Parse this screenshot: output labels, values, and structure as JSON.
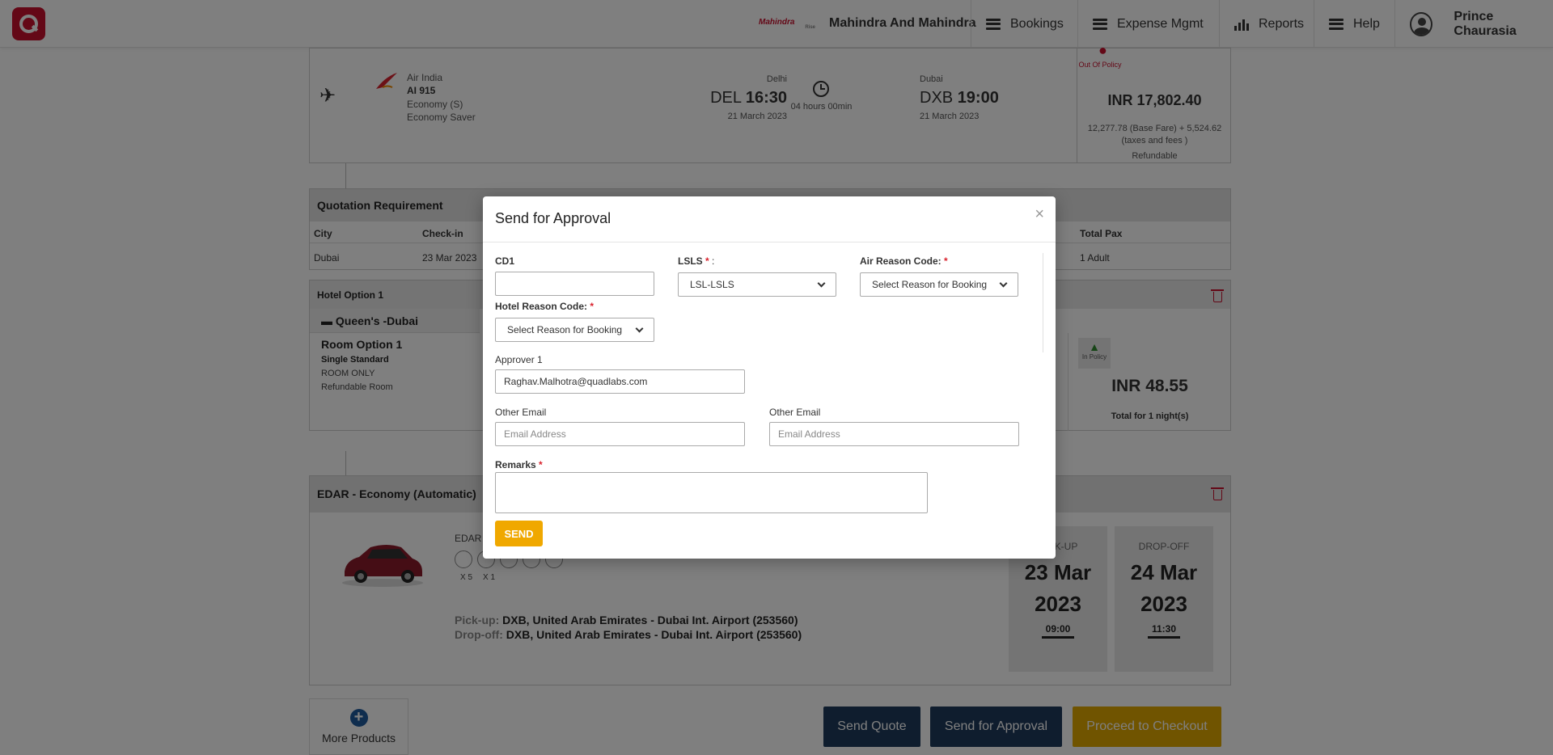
{
  "nav": {
    "brand_logo_text": "Mahindra",
    "brand_logo_sub": "Rise",
    "company": "Mahindra And Mahindra",
    "items": [
      {
        "label": "Bookings"
      },
      {
        "label": "Expense Mgmt"
      },
      {
        "label": "Reports"
      },
      {
        "label": "Help"
      }
    ],
    "user_name": "Prince Chaurasia"
  },
  "flight": {
    "airline": "Air India",
    "flight_no": "AI 915",
    "cabin": "Economy (S)",
    "fare_type": "Economy Saver",
    "from_city": "Delhi",
    "from_code": "DEL",
    "dep_time": "16:30",
    "dep_date": "21 March 2023",
    "duration": "04 hours 00min",
    "to_city": "Dubai",
    "to_code": "DXB",
    "arr_time": "19:00",
    "arr_date": "21 March 2023",
    "policy": "Out Of Policy",
    "price": "INR 17,802.40",
    "breakdown_1": "12,277.78 (Base Fare) + 5,524.62",
    "breakdown_2": "(taxes and fees )",
    "refund": "Refundable"
  },
  "quotation": {
    "title": "Quotation Requirement",
    "headers": {
      "city": "City",
      "checkin": "Check-in",
      "total_pax": "Total Pax"
    },
    "row": {
      "city": "Dubai",
      "checkin": "23 Mar 2023",
      "total_pax": "1 Adult"
    }
  },
  "hotel": {
    "option_title": "Hotel Option 1",
    "name": "Queen's -Dubai",
    "room_option": "Room Option 1",
    "room_type": "Single Standard",
    "meal": "ROOM ONLY",
    "refund": "Refundable Room",
    "policy": "In Policy",
    "price": "INR 48.55",
    "price_note": "Total for 1 night(s)"
  },
  "car": {
    "title": "EDAR - Economy (Automatic)",
    "code": "EDAR",
    "seats": "X 5",
    "bags": "X 1",
    "pickup_label": "Pick-up:",
    "pickup_value": "DXB, United Arab Emirates - Dubai Int. Airport (253560)",
    "dropoff_label": "Drop-off:",
    "dropoff_value": "DXB, United Arab Emirates - Dubai Int. Airport (253560)",
    "pickup_box_label": "PICK-UP",
    "pickup_date_1": "23 Mar",
    "pickup_date_2": "2023",
    "pickup_time": "09:00",
    "dropoff_box_label": "DROP-OFF",
    "dropoff_date_1": "24 Mar",
    "dropoff_date_2": "2023",
    "dropoff_time": "11:30"
  },
  "footer": {
    "more_products": "More Products",
    "send_quote": "Send Quote",
    "send_for_approval": "Send for Approval",
    "proceed": "Proceed to Checkout"
  },
  "modal": {
    "title": "Send for Approval",
    "close": "×",
    "cd1_label": "CD1",
    "cd1_value": "",
    "lsls_label": "LSLS",
    "lsls_suffix": " :",
    "lsls_value": "LSL-LSLS",
    "air_reason_label": "Air Reason Code:",
    "air_reason_value": "Select Reason for Booking",
    "hotel_reason_label": "Hotel Reason Code:",
    "hotel_reason_value": "Select Reason for Booking",
    "required_mark": "*",
    "approver_label": "Approver 1",
    "approver_value": "Raghav.Malhotra@quadlabs.com",
    "other_email_label_1": "Other Email",
    "other_email_label_2": "Other Email",
    "email_placeholder": "Email Address",
    "remarks_label": "Remarks",
    "send_label": "SEND"
  },
  "colors": {
    "brand_red": "#c8102e",
    "send_yellow": "#f0a800",
    "navy_button": "#1f3b5c",
    "checkout_yellow": "#e0a800"
  }
}
